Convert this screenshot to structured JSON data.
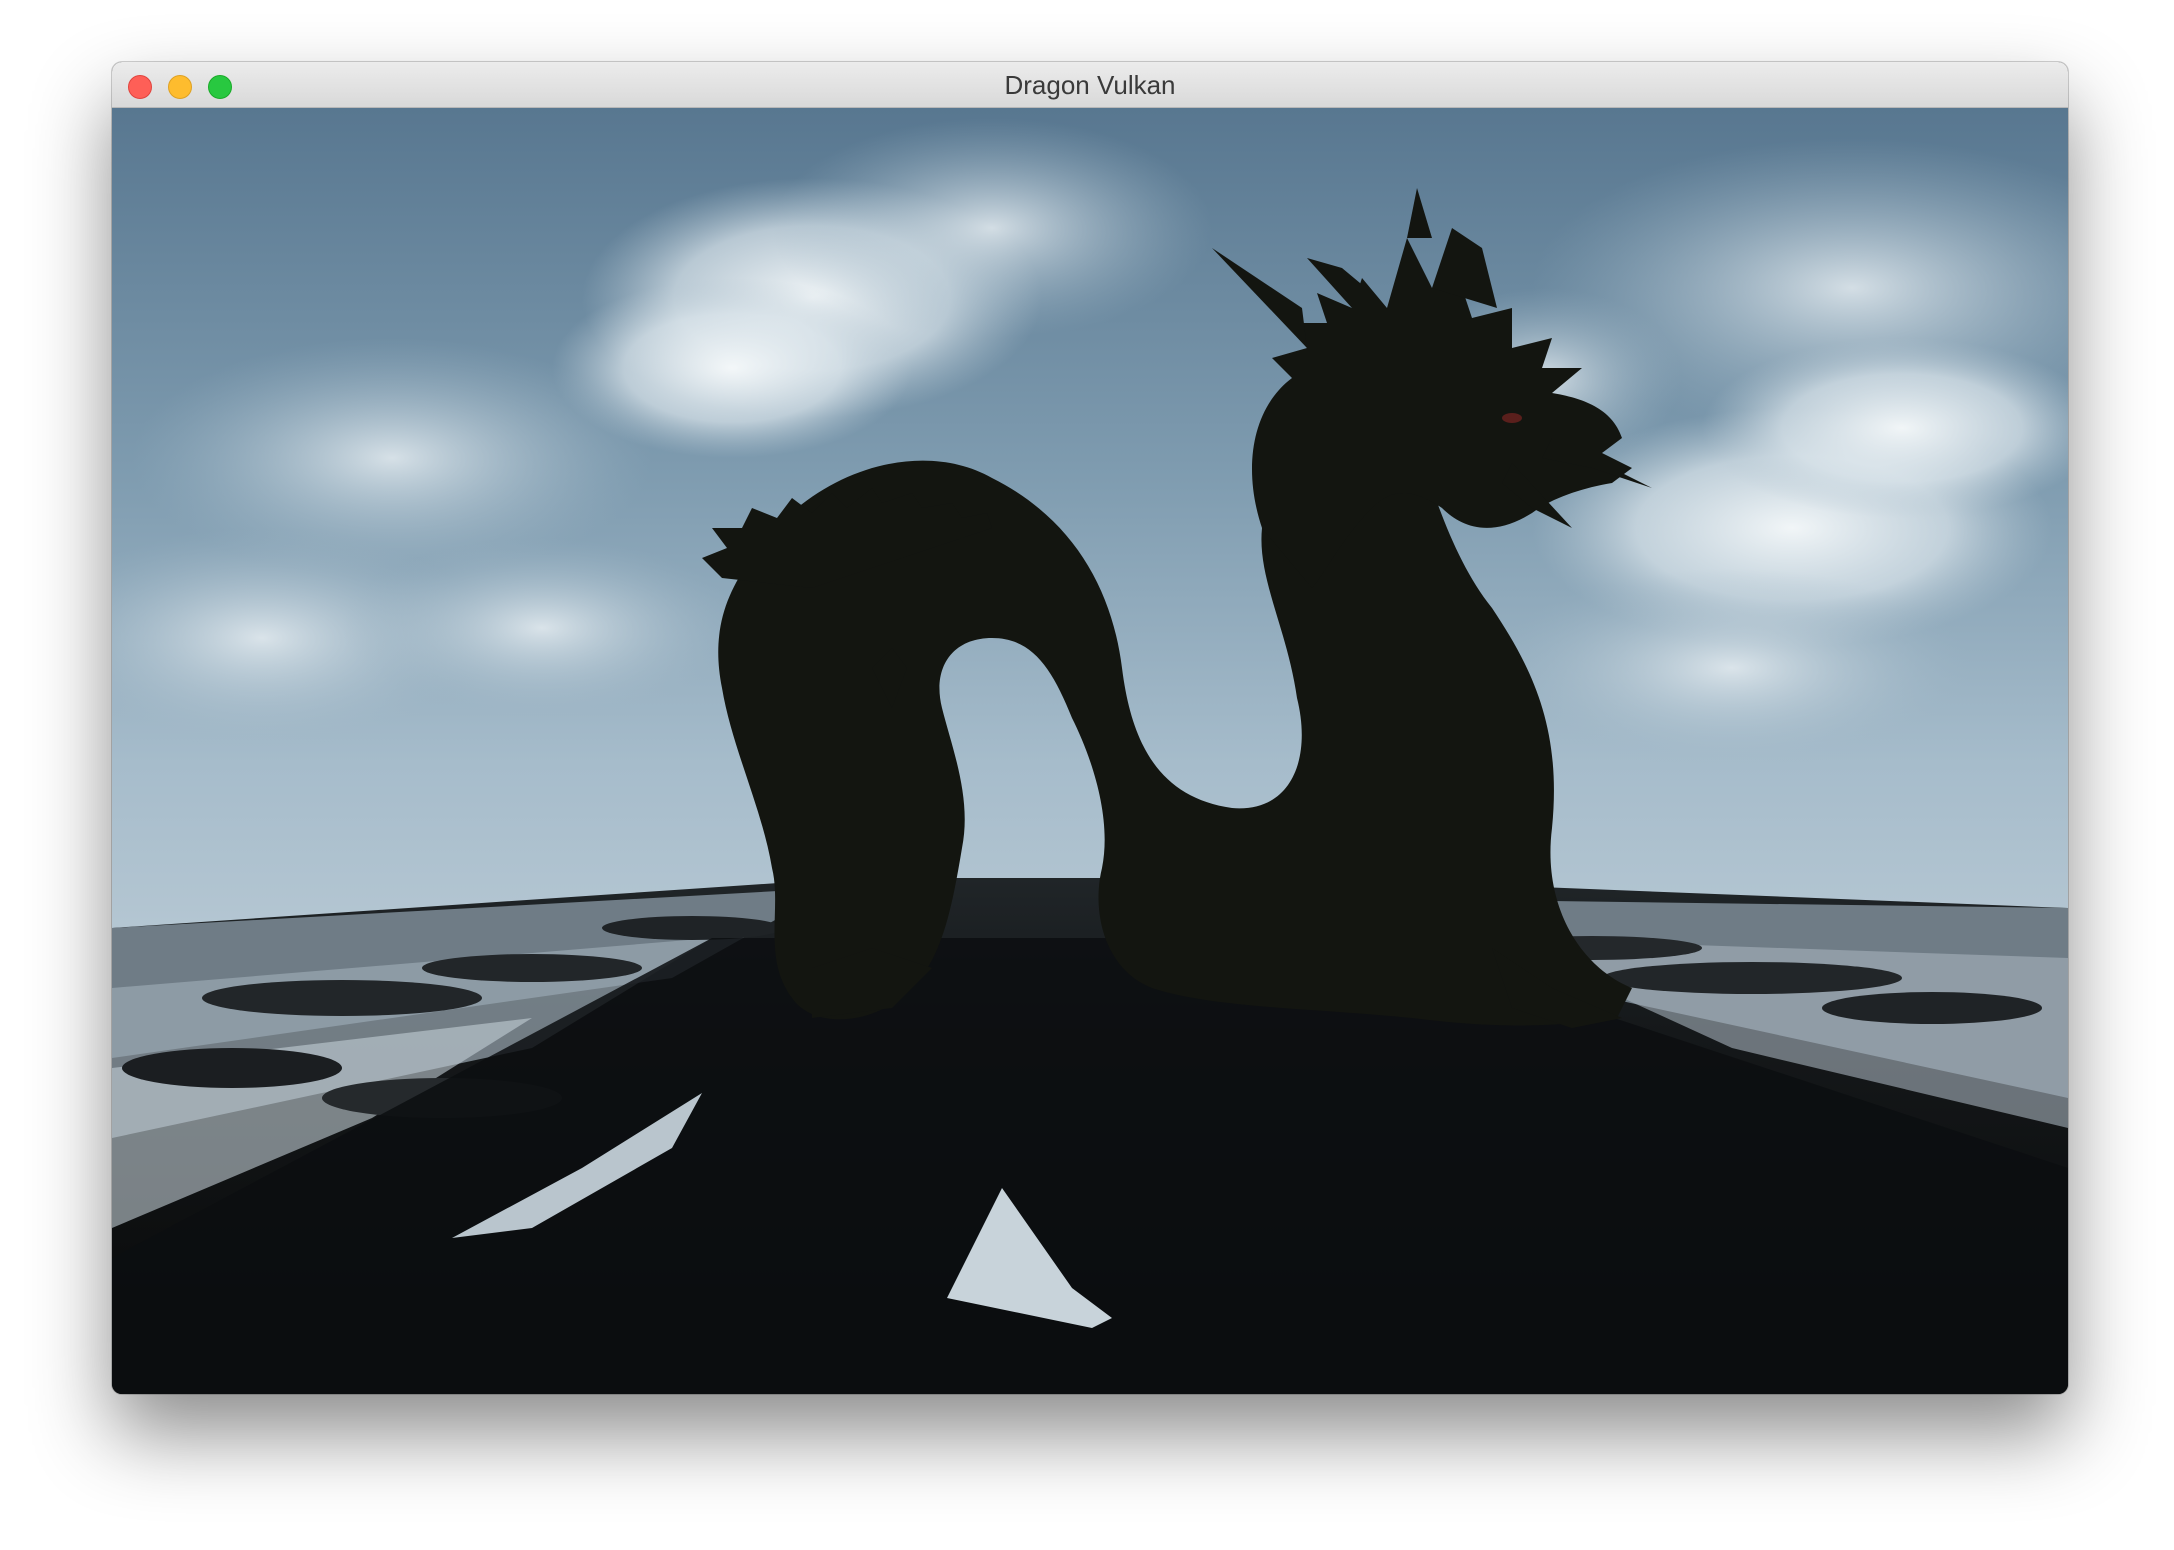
{
  "window": {
    "title": "Dragon Vulkan",
    "controls": {
      "close": "close-button",
      "minimize": "minimize-button",
      "zoom": "zoom-button"
    }
  },
  "scene": {
    "description_icons": [
      "sky-clouds",
      "dragon-silhouette",
      "reflective-ground-plane"
    ],
    "colors": {
      "sky_top": "#5c7b92",
      "sky_bottom": "#a9bfcd",
      "cloud": "#f2f6f8",
      "ground_dark": "#0d0f11",
      "ground_reflect": "#aebac4",
      "dragon": "#141612"
    }
  }
}
